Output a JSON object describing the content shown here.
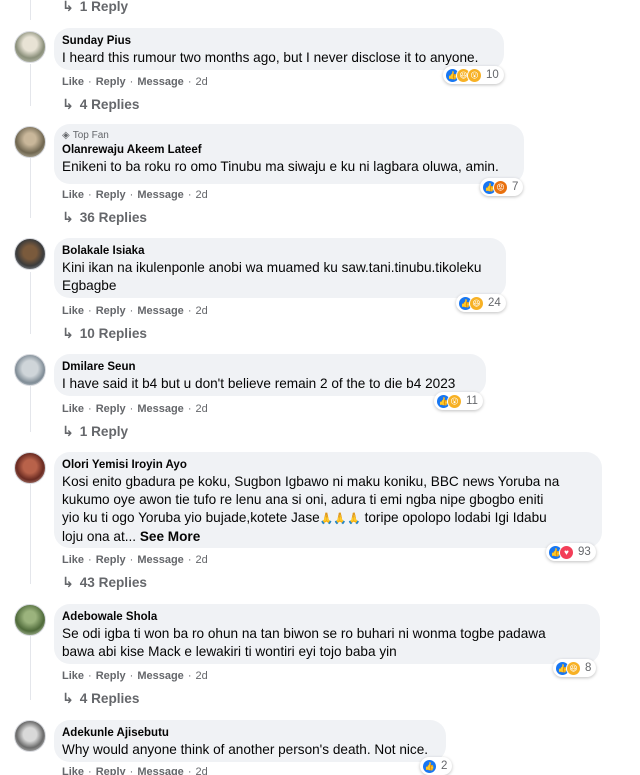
{
  "top_partial": {
    "replies_label": "1 Reply"
  },
  "actions": {
    "like": "Like",
    "reply": "Reply",
    "message": "Message",
    "sep": "·"
  },
  "comments": [
    {
      "author": "Sunday Pius",
      "text": "I heard this rumour two months ago, but I never disclose it to anyone.",
      "time": "2d",
      "reaction_count": "10",
      "replies_label": "4 Replies",
      "top_fan": ""
    },
    {
      "author": "Olanrewaju Akeem Lateef",
      "text": "Enikeni to ba roku ro omo Tinubu ma siwaju e ku ni lagbara oluwa, amin.",
      "time": "2d",
      "reaction_count": "7",
      "replies_label": "36 Replies",
      "top_fan": "Top Fan"
    },
    {
      "author": "Bolakale Isiaka",
      "text_lines": [
        "Kini ikan na ikulenponle anobi wa muamed ku saw.tani.tinubu.tikoleku",
        "Egbagbe"
      ],
      "time": "2d",
      "reaction_count": "24",
      "replies_label": "10 Replies",
      "top_fan": ""
    },
    {
      "author": "Dmilare Seun",
      "text": "I have said it b4 but u don't believe remain 2 of the to die b4 2023",
      "time": "2d",
      "reaction_count": "11",
      "replies_label": "1 Reply",
      "top_fan": ""
    },
    {
      "author": "Olori Yemisi Iroyin Ayo",
      "text_lines": [
        "Kosi enito gbadura pe koku, Sugbon Igbawo ni maku koniku, BBC news Yoruba na",
        "kukumo oye awon tie tufo re lenu ana si oni, adura ti emi ngba nipe gbogbo eniti",
        "yio ku ti ogo Yoruba yio bujade,kotete Jase",
        " toripe opolopo lodabi Igi Idabu",
        "loju ona at..."
      ],
      "emoji": "🙏🙏🙏",
      "see_more": "See More",
      "time": "2d",
      "reaction_count": "93",
      "replies_label": "43 Replies",
      "top_fan": ""
    },
    {
      "author": "Adebowale Shola",
      "text_lines": [
        "Se odi igba ti won ba ro ohun na tan biwon se ro buhari ni wonma togbe padawa",
        "bawa abi kise Mack e lewakiri ti wontiri eyi tojo baba yin"
      ],
      "time": "2d",
      "reaction_count": "8",
      "replies_label": "4 Replies",
      "top_fan": ""
    },
    {
      "author": "Adekunle Ajisebutu",
      "text": "Why would anyone think of another person's death. Not nice.",
      "time": "2d",
      "reaction_count": "2",
      "replies_label": "",
      "top_fan": ""
    }
  ],
  "colors": {
    "like": "#1877f2",
    "haha": "#f7b125",
    "love": "#f33e58",
    "angry": "#e9710f",
    "bubble": "#f0f2f5",
    "meta": "#65676b"
  }
}
